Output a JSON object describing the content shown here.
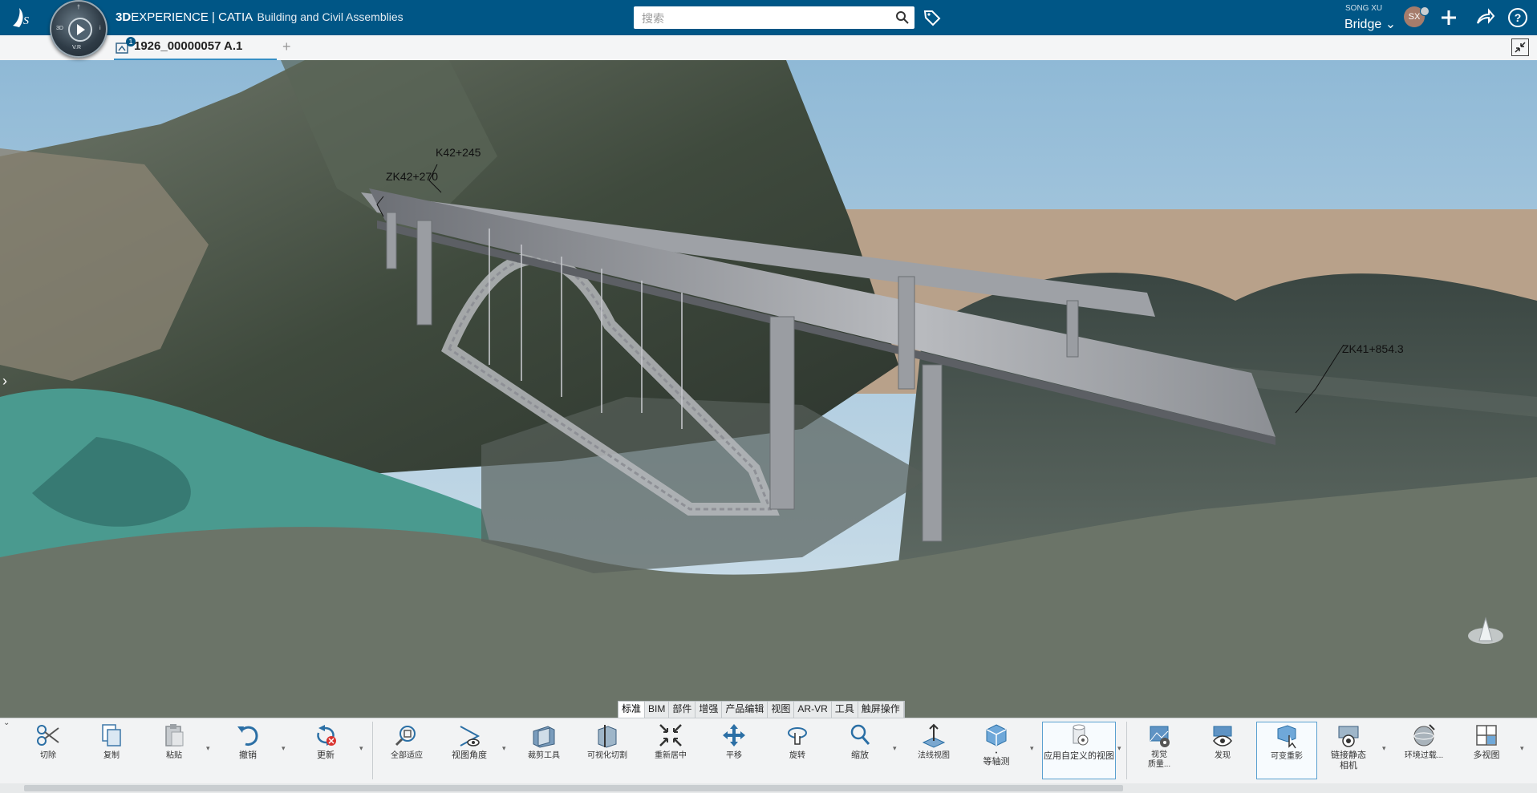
{
  "header": {
    "brand_prefix": "3D",
    "brand_main": "EXPERIENCE | CATIA",
    "app_name": "Building and Civil Assemblies",
    "compass_labels": {
      "left": "3D",
      "bottom": "V.R",
      "right": "i",
      "top": "†"
    },
    "search_placeholder": "搜索",
    "user_name": "SONG XU",
    "collab_space": "Bridge ⌄",
    "avatar_initials": "SX"
  },
  "tabs": {
    "active_doc": "1926_00000057 A.1",
    "badge_count": "1",
    "add_tab": "+"
  },
  "viewport": {
    "annotations": [
      "K42+245",
      "ZK42+270",
      "ZK41+854.3"
    ],
    "side_toggle": "›"
  },
  "workbench_tabs": [
    "标准",
    "BIM",
    "部件",
    "增强",
    "产品编辑",
    "视图",
    "AR-VR",
    "工具",
    "触屏操作"
  ],
  "active_workbench_tab": 0,
  "actions": {
    "cut": "切除",
    "copy": "复制",
    "paste": "粘贴",
    "undo": "撤销",
    "update": "更新",
    "fit_all": "全部适应",
    "view_angle": "视图角度",
    "clip_tool": "裁剪工具",
    "visual_cut": "可视化切割",
    "recenter": "重新居中",
    "pan": "平移",
    "rotate": "旋转",
    "zoom": "缩放",
    "normal_view": "法线视图",
    "isometric": "等轴测",
    "apply_custom_view": "应用自定义的视图",
    "visual_quality_1": "视觉",
    "visual_quality_2": "质量...",
    "discover": "发现",
    "variable_shadow": "可变重影",
    "link_camera_1": "链接静态",
    "link_camera_2": "相机",
    "env_filter": "环境过载...",
    "multi_view": "多视图"
  },
  "colors": {
    "brand_blue": "#005686",
    "tab_underline": "#368ec4",
    "water": "#4a9a8f",
    "sky": "#bcd6e6",
    "sand": "#b8a18a"
  }
}
